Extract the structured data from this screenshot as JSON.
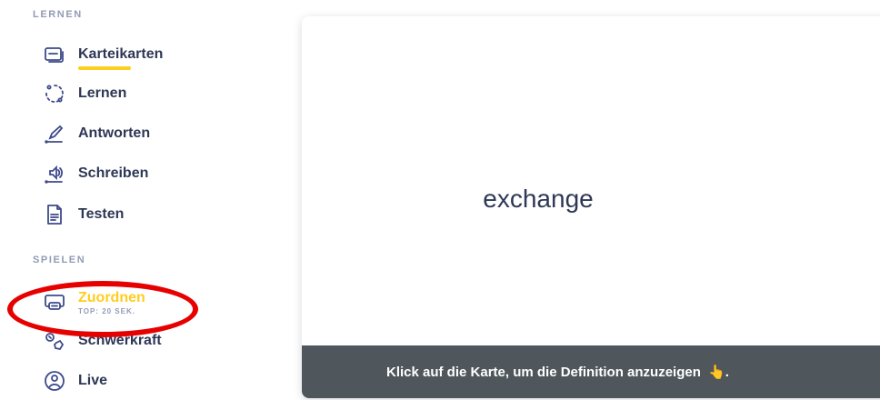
{
  "sidebar": {
    "sections": {
      "learn": "LERNEN",
      "play": "SPIELEN"
    },
    "items": [
      {
        "label": "Karteikarten",
        "icon": "flashcards-icon"
      },
      {
        "label": "Lernen",
        "icon": "learn-cycle-icon"
      },
      {
        "label": "Antworten",
        "icon": "write-pen-icon"
      },
      {
        "label": "Schreiben",
        "icon": "speaker-spell-icon"
      },
      {
        "label": "Testen",
        "icon": "test-document-icon"
      },
      {
        "label": "Zuordnen",
        "sub": "TOP: 20 SEK.",
        "icon": "match-cards-icon"
      },
      {
        "label": "Schwerkraft",
        "icon": "gravity-icon"
      },
      {
        "label": "Live",
        "icon": "live-people-icon"
      }
    ]
  },
  "card": {
    "term": "exchange",
    "footer_hint": "Klick auf die Karte, um die Definition anzuzeigen",
    "footer_emoji": "👆",
    "footer_period": "."
  },
  "colors": {
    "accent_yellow": "#ffcd1f",
    "text": "#2e3856",
    "muted": "#939bb4",
    "footer_bg": "#4f575c",
    "highlight_red": "#e60000"
  }
}
